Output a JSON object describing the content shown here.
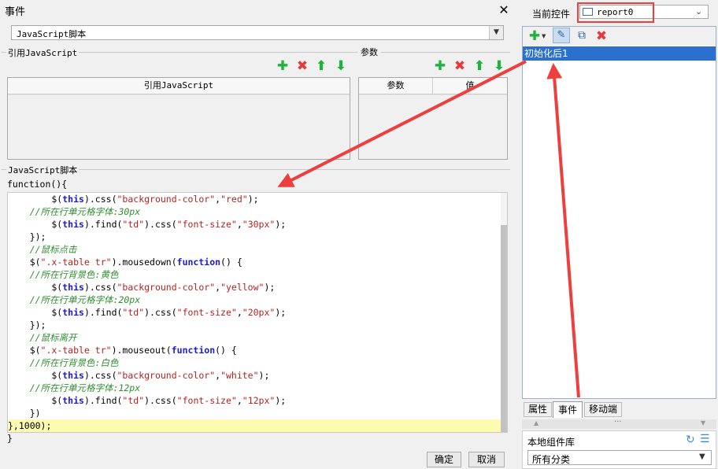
{
  "dialog": {
    "title": "事件",
    "close_glyph": "✕",
    "event_type": "JavaScript脚本",
    "ref_js_group": "引用JavaScript",
    "ref_js_column": "引用JavaScript",
    "params_group": "参数",
    "params_columns": [
      "参数",
      "值"
    ],
    "script_group": "JavaScript脚本",
    "function_open": "function(){",
    "function_close": "}",
    "ok_label": "确定",
    "cancel_label": "取消"
  },
  "code_lines": [
    [
      {
        "t": "        $(",
        "c": ""
      },
      {
        "t": "this",
        "c": "kw"
      },
      {
        "t": ").css(",
        "c": ""
      },
      {
        "t": "\"background-color\"",
        "c": "str"
      },
      {
        "t": ",",
        "c": ""
      },
      {
        "t": "\"red\"",
        "c": "str"
      },
      {
        "t": ");",
        "c": ""
      }
    ],
    [
      {
        "t": "    //所在行单元格字体:30px",
        "c": "cm"
      }
    ],
    [
      {
        "t": "        $(",
        "c": ""
      },
      {
        "t": "this",
        "c": "kw"
      },
      {
        "t": ").find(",
        "c": ""
      },
      {
        "t": "\"td\"",
        "c": "str"
      },
      {
        "t": ").css(",
        "c": ""
      },
      {
        "t": "\"font-size\"",
        "c": "str"
      },
      {
        "t": ",",
        "c": ""
      },
      {
        "t": "\"30px\"",
        "c": "str"
      },
      {
        "t": ");",
        "c": ""
      }
    ],
    [
      {
        "t": "    });",
        "c": ""
      }
    ],
    [
      {
        "t": "    //鼠标点击",
        "c": "cm"
      }
    ],
    [
      {
        "t": "    $(",
        "c": ""
      },
      {
        "t": "\".x-table tr\"",
        "c": "str"
      },
      {
        "t": ").mousedown(",
        "c": ""
      },
      {
        "t": "function",
        "c": "kw"
      },
      {
        "t": "() {",
        "c": ""
      }
    ],
    [
      {
        "t": "    //所在行背景色:黄色",
        "c": "cm"
      }
    ],
    [
      {
        "t": "        $(",
        "c": ""
      },
      {
        "t": "this",
        "c": "kw"
      },
      {
        "t": ").css(",
        "c": ""
      },
      {
        "t": "\"background-color\"",
        "c": "str"
      },
      {
        "t": ",",
        "c": ""
      },
      {
        "t": "\"yellow\"",
        "c": "str"
      },
      {
        "t": ");",
        "c": ""
      }
    ],
    [
      {
        "t": "    //所在行单元格字体:20px",
        "c": "cm"
      }
    ],
    [
      {
        "t": "        $(",
        "c": ""
      },
      {
        "t": "this",
        "c": "kw"
      },
      {
        "t": ").find(",
        "c": ""
      },
      {
        "t": "\"td\"",
        "c": "str"
      },
      {
        "t": ").css(",
        "c": ""
      },
      {
        "t": "\"font-size\"",
        "c": "str"
      },
      {
        "t": ",",
        "c": ""
      },
      {
        "t": "\"20px\"",
        "c": "str"
      },
      {
        "t": ");",
        "c": ""
      }
    ],
    [
      {
        "t": "    });",
        "c": ""
      }
    ],
    [
      {
        "t": "    //鼠标离开",
        "c": "cm"
      }
    ],
    [
      {
        "t": "    $(",
        "c": ""
      },
      {
        "t": "\".x-table tr\"",
        "c": "str"
      },
      {
        "t": ").mouseout(",
        "c": ""
      },
      {
        "t": "function",
        "c": "kw"
      },
      {
        "t": "() {",
        "c": ""
      }
    ],
    [
      {
        "t": "    //所在行背景色:白色",
        "c": "cm"
      }
    ],
    [
      {
        "t": "        $(",
        "c": ""
      },
      {
        "t": "this",
        "c": "kw"
      },
      {
        "t": ").css(",
        "c": ""
      },
      {
        "t": "\"background-color\"",
        "c": "str"
      },
      {
        "t": ",",
        "c": ""
      },
      {
        "t": "\"white\"",
        "c": "str"
      },
      {
        "t": ");",
        "c": ""
      }
    ],
    [
      {
        "t": "    //所在行单元格字体:12px",
        "c": "cm"
      }
    ],
    [
      {
        "t": "        $(",
        "c": ""
      },
      {
        "t": "this",
        "c": "kw"
      },
      {
        "t": ").find(",
        "c": ""
      },
      {
        "t": "\"td\"",
        "c": "str"
      },
      {
        "t": ").css(",
        "c": ""
      },
      {
        "t": "\"font-size\"",
        "c": "str"
      },
      {
        "t": ",",
        "c": ""
      },
      {
        "t": "\"12px\"",
        "c": "str"
      },
      {
        "t": ");",
        "c": ""
      }
    ],
    [
      {
        "t": "    })",
        "c": ""
      }
    ],
    [
      {
        "t": "},1000);",
        "c": ""
      }
    ]
  ],
  "right_panel": {
    "current_widget_label": "当前控件",
    "current_widget_value": "report0",
    "event_item": "初始化后1",
    "tabs": [
      "属性",
      "事件",
      "移动端"
    ],
    "active_tab": "事件",
    "library_label": "本地组件库",
    "category_value": "所有分类"
  },
  "colors": {
    "selection": "#2b6fcf",
    "annotation_red": "#ee3f3f",
    "current_line": "#fdfbb0"
  }
}
